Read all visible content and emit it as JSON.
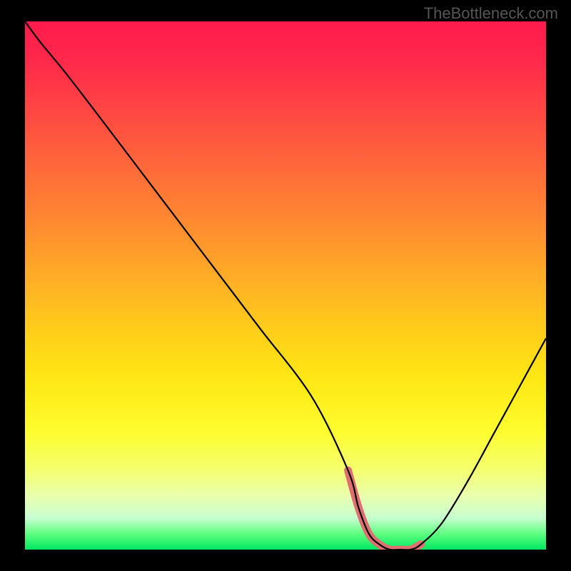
{
  "watermark": "TheBottleneck.com",
  "chart_data": {
    "type": "line",
    "title": "",
    "xlabel": "",
    "ylabel": "",
    "x": [
      0,
      3,
      8,
      15,
      25,
      35,
      45,
      55,
      62,
      64,
      66,
      68,
      70,
      72,
      74,
      76,
      80,
      85,
      90,
      95,
      100
    ],
    "values": [
      100,
      96,
      90,
      81,
      68,
      55,
      42,
      29,
      15,
      8,
      3,
      1,
      0,
      0,
      0,
      1,
      5,
      13,
      22,
      31,
      40
    ],
    "xlim": [
      0,
      100
    ],
    "ylim": [
      0,
      100
    ],
    "highlight_range": {
      "x_start": 62,
      "x_end": 77
    },
    "background_gradient": {
      "top_color": "#ff1a4d",
      "bottom_color": "#00e860",
      "description": "red to yellow to green vertical gradient"
    }
  }
}
